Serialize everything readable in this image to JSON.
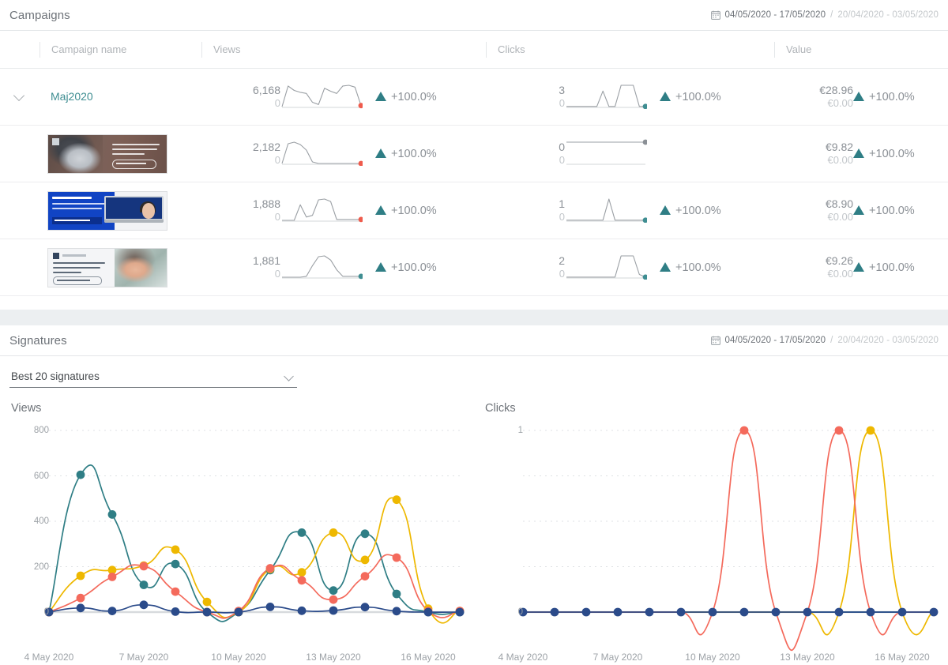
{
  "campaigns": {
    "title": "Campaigns",
    "daterange": {
      "icon": "calendar-icon",
      "current": "04/05/2020 - 17/05/2020",
      "separator": "/",
      "previous": "20/04/2020 - 03/05/2020"
    },
    "columns": [
      "Campaign name",
      "Views",
      "Clicks",
      "Value"
    ],
    "rows": [
      {
        "type": "group",
        "caret": "chevron-down-icon",
        "name": "Maj2020",
        "views": "6,168",
        "views_prev": "0",
        "views_change": "+100.0%",
        "views_change_dir": "up",
        "clicks": "3",
        "clicks_prev": "0",
        "clicks_change": "+100.0%",
        "clicks_change_dir": "up",
        "value": "€28.96",
        "value_prev": "€0.00",
        "value_change": "+100.0%",
        "value_change_dir": "up",
        "views_spark": [
          2,
          58,
          46,
          41,
          38,
          14,
          8,
          52,
          44,
          38,
          58,
          60,
          55,
          5
        ],
        "views_spark_dot": "#ef5b4c",
        "clicks_spark": [
          2,
          2,
          2,
          2,
          2,
          2,
          34,
          2,
          2,
          46,
          46,
          46,
          2,
          2
        ],
        "clicks_spark_dot": "#3f8e92"
      },
      {
        "type": "creative",
        "thumb": "banner-email-communication",
        "views": "2,182",
        "views_prev": "0",
        "views_change": "+100.0%",
        "views_change_dir": "up",
        "clicks": "0",
        "clicks_prev": "0",
        "clicks_change": "",
        "clicks_change_dir": "none",
        "value": "€9.82",
        "value_prev": "€0.00",
        "value_change": "+100.0%",
        "value_change_dir": "up",
        "views_spark": [
          2,
          52,
          56,
          50,
          36,
          6,
          2,
          2,
          2,
          2,
          2,
          2,
          2,
          2
        ],
        "views_spark_dot": "#ef5b4c",
        "clicks_spark": [
          2,
          2,
          2,
          2,
          2,
          2,
          2,
          2,
          2,
          2,
          2,
          2,
          2,
          2
        ],
        "clicks_spark_dot": "#8b9096"
      },
      {
        "type": "creative",
        "thumb": "banner-video-background",
        "views": "1,888",
        "views_prev": "0",
        "views_change": "+100.0%",
        "views_change_dir": "up",
        "clicks": "1",
        "clicks_prev": "0",
        "clicks_change": "+100.0%",
        "clicks_change_dir": "up",
        "value": "€8.90",
        "value_prev": "€0.00",
        "value_change": "+100.0%",
        "value_change_dir": "up",
        "views_spark": [
          2,
          2,
          2,
          40,
          10,
          14,
          52,
          54,
          48,
          4,
          4,
          4,
          4,
          4
        ],
        "views_spark_dot": "#ef5b4c",
        "clicks_spark": [
          2,
          2,
          2,
          2,
          2,
          2,
          2,
          48,
          2,
          2,
          2,
          2,
          2,
          2
        ],
        "clicks_spark_dot": "#3f8e92"
      },
      {
        "type": "creative",
        "thumb": "banner-email-signature",
        "views": "1,881",
        "views_prev": "0",
        "views_change": "+100.0%",
        "views_change_dir": "up",
        "clicks": "2",
        "clicks_prev": "0",
        "clicks_change": "+100.0%",
        "clicks_change_dir": "up",
        "value": "€9.26",
        "value_prev": "€0.00",
        "value_change": "+100.0%",
        "value_change_dir": "up",
        "views_spark": [
          2,
          2,
          2,
          2,
          4,
          30,
          52,
          54,
          44,
          20,
          4,
          4,
          4,
          4
        ],
        "views_spark_dot": "#3f8e92",
        "clicks_spark": [
          2,
          2,
          2,
          2,
          2,
          2,
          2,
          2,
          2,
          50,
          50,
          50,
          8,
          2
        ],
        "clicks_spark_dot": "#3f8e92"
      }
    ]
  },
  "signatures": {
    "title": "Signatures",
    "daterange": {
      "icon": "calendar-icon",
      "current": "04/05/2020 - 17/05/2020",
      "separator": "/",
      "previous": "20/04/2020 - 03/05/2020"
    },
    "selector": {
      "value": "Best 20 signatures",
      "icon": "chevron-down-icon"
    }
  },
  "chart_data": [
    {
      "type": "line",
      "title": "Views",
      "xlabel": "",
      "ylabel": "",
      "grid": true,
      "legend": "none",
      "ylim": [
        0,
        800
      ],
      "yticks": [
        0,
        200,
        400,
        600,
        800
      ],
      "x": [
        "4 May 2020",
        "5 May 2020",
        "6 May 2020",
        "7 May 2020",
        "8 May 2020",
        "9 May 2020",
        "10 May 2020",
        "11 May 2020",
        "12 May 2020",
        "13 May 2020",
        "14 May 2020",
        "15 May 2020",
        "16 May 2020",
        "17 May 2020"
      ],
      "xticklabels": [
        "4 May 2020",
        "7 May 2020",
        "10 May 2020",
        "13 May 2020",
        "16 May 2020"
      ],
      "xtickindices": [
        0,
        3,
        6,
        9,
        12
      ],
      "series": [
        {
          "name": "series-teal",
          "color": "#2f7e85",
          "values": [
            0,
            605,
            430,
            120,
            212,
            0,
            0,
            185,
            350,
            95,
            345,
            80,
            0,
            0
          ]
        },
        {
          "name": "series-yellow",
          "color": "#eeb800",
          "values": [
            0,
            160,
            185,
            205,
            275,
            45,
            0,
            190,
            175,
            350,
            230,
            495,
            15,
            5
          ]
        },
        {
          "name": "series-red",
          "color": "#f46a5c",
          "values": [
            0,
            62,
            155,
            202,
            90,
            0,
            5,
            193,
            140,
            55,
            158,
            240,
            5,
            5
          ]
        },
        {
          "name": "series-navy",
          "color": "#2b4b8a",
          "values": [
            0,
            18,
            5,
            32,
            2,
            0,
            0,
            23,
            6,
            7,
            22,
            4,
            0,
            0
          ]
        }
      ]
    },
    {
      "type": "line",
      "title": "Clicks",
      "xlabel": "",
      "ylabel": "",
      "grid": true,
      "legend": "none",
      "ylim": [
        0,
        1
      ],
      "yticks": [
        0,
        1
      ],
      "x": [
        "4 May 2020",
        "5 May 2020",
        "6 May 2020",
        "7 May 2020",
        "8 May 2020",
        "9 May 2020",
        "10 May 2020",
        "11 May 2020",
        "12 May 2020",
        "13 May 2020",
        "14 May 2020",
        "15 May 2020",
        "16 May 2020",
        "17 May 2020"
      ],
      "xticklabels": [
        "4 May 2020",
        "7 May 2020",
        "10 May 2020",
        "13 May 2020",
        "16 May 2020"
      ],
      "xtickindices": [
        0,
        3,
        6,
        9,
        12
      ],
      "series": [
        {
          "name": "series-teal",
          "color": "#2f7e85",
          "values": [
            0,
            0,
            0,
            0,
            0,
            0,
            0,
            0,
            0,
            0,
            0,
            0,
            0,
            0
          ]
        },
        {
          "name": "series-yellow",
          "color": "#eeb800",
          "values": [
            0,
            0,
            0,
            0,
            0,
            0,
            0,
            0,
            0,
            0,
            0,
            1,
            0,
            0
          ]
        },
        {
          "name": "series-red",
          "color": "#f46a5c",
          "values": [
            0,
            0,
            0,
            0,
            0,
            0,
            0,
            1,
            0,
            0,
            1,
            0,
            0,
            0
          ]
        },
        {
          "name": "series-navy",
          "color": "#2b4b8a",
          "values": [
            0,
            0,
            0,
            0,
            0,
            0,
            0,
            0,
            0,
            0,
            0,
            0,
            0,
            0
          ]
        }
      ]
    }
  ],
  "colors": {
    "accent": "#3f8e92",
    "positive": "#2f7e85",
    "teal": "#2f7e85",
    "yellow": "#eeb800",
    "red": "#f46a5c",
    "navy": "#2b4b8a",
    "muted": "#8b9096"
  }
}
